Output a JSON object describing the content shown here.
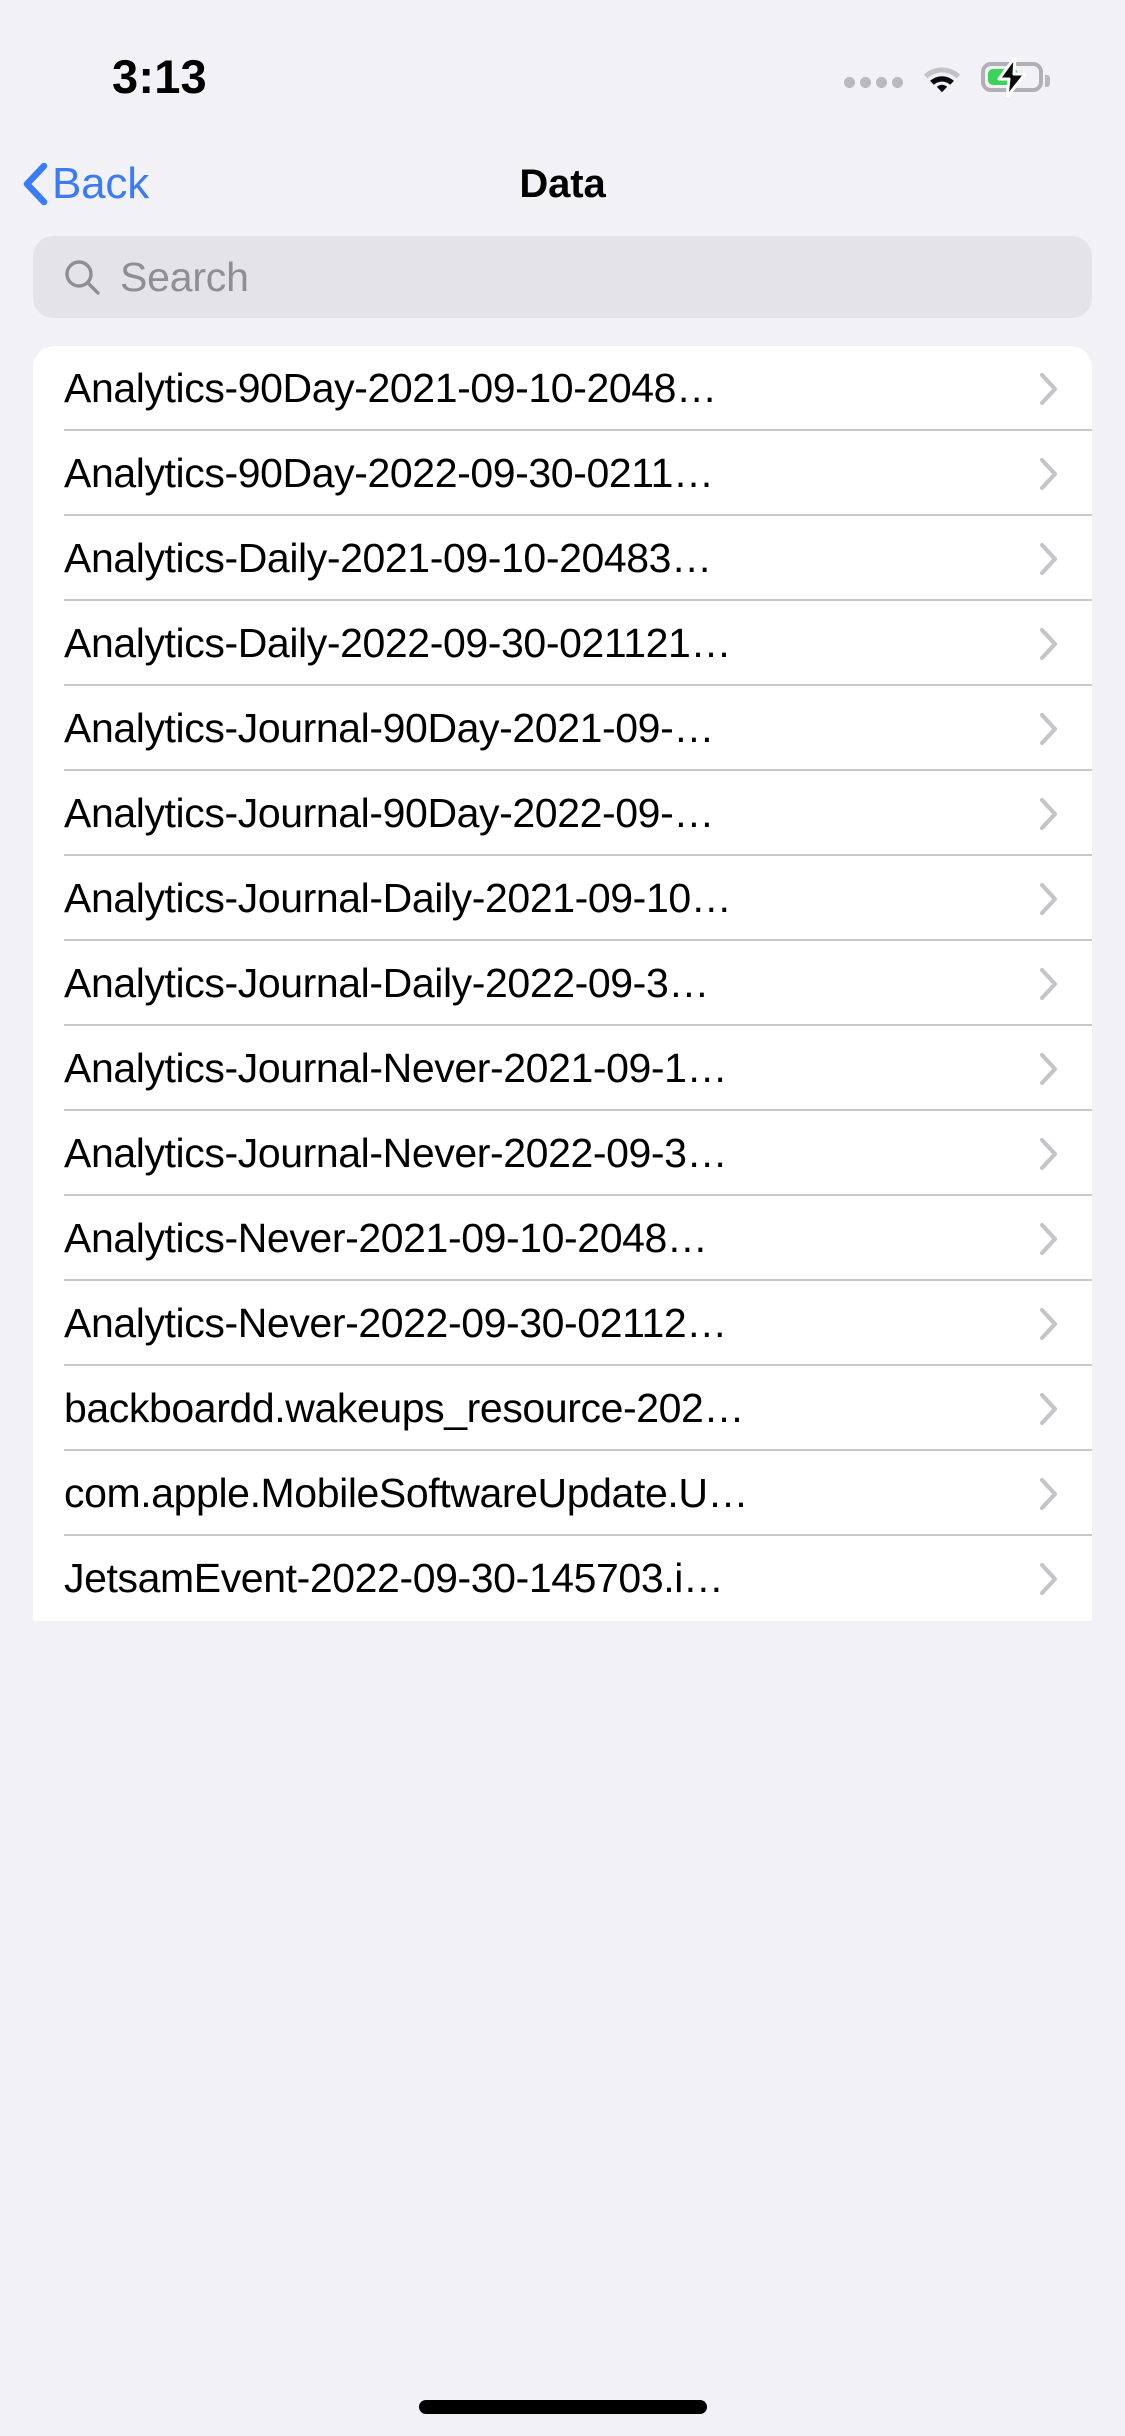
{
  "status_bar": {
    "time": "3:13",
    "cellular_icon": "cellular-dots-icon",
    "wifi_icon": "wifi-icon",
    "battery_icon": "battery-charging-icon",
    "battery_level_percent": 62,
    "colors": {
      "battery_green": "#3bd35a",
      "inactive_gray": "#b9b9c0"
    }
  },
  "nav": {
    "back_label": "Back",
    "back_icon": "chevron-left-icon",
    "title": "Data",
    "accent_color": "#3b7cf6"
  },
  "search": {
    "placeholder": "Search",
    "value": "",
    "icon": "search-icon"
  },
  "list": {
    "chevron_icon": "chevron-right-icon",
    "items": [
      {
        "label": "Analytics-90Day-2021-09-10-2048…"
      },
      {
        "label": "Analytics-90Day-2022-09-30-0211…"
      },
      {
        "label": "Analytics-Daily-2021-09-10-20483…"
      },
      {
        "label": "Analytics-Daily-2022-09-30-021121…"
      },
      {
        "label": "Analytics-Journal-90Day-2021-09-…"
      },
      {
        "label": "Analytics-Journal-90Day-2022-09-…"
      },
      {
        "label": "Analytics-Journal-Daily-2021-09-10…"
      },
      {
        "label": "Analytics-Journal-Daily-2022-09-3…"
      },
      {
        "label": "Analytics-Journal-Never-2021-09-1…"
      },
      {
        "label": "Analytics-Journal-Never-2022-09-3…"
      },
      {
        "label": "Analytics-Never-2021-09-10-2048…"
      },
      {
        "label": "Analytics-Never-2022-09-30-02112…"
      },
      {
        "label": "backboardd.wakeups_resource-202…"
      },
      {
        "label": "com.apple.MobileSoftwareUpdate.U…"
      },
      {
        "label": "JetsamEvent-2022-09-30-145703.i…"
      }
    ]
  },
  "home_indicator": {
    "present": true
  }
}
